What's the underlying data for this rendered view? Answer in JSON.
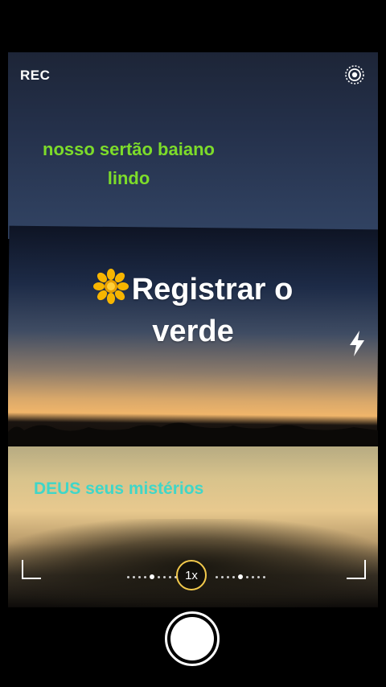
{
  "camera": {
    "rec_label": "REC",
    "zoom_label": "1x"
  },
  "overlay": {
    "green_text": "nosso sertão baiano lindo",
    "main_text": "Registrar o verde",
    "cyan_text": "DEUS seus mistérios"
  },
  "icons": {
    "settings": "settings-icon",
    "flower": "flower-icon",
    "flash": "flash-icon",
    "shutter": "shutter-button"
  },
  "colors": {
    "green_text": "#7ddc2a",
    "cyan_text": "#3fd6c8",
    "zoom_ring": "#f2c94c"
  }
}
